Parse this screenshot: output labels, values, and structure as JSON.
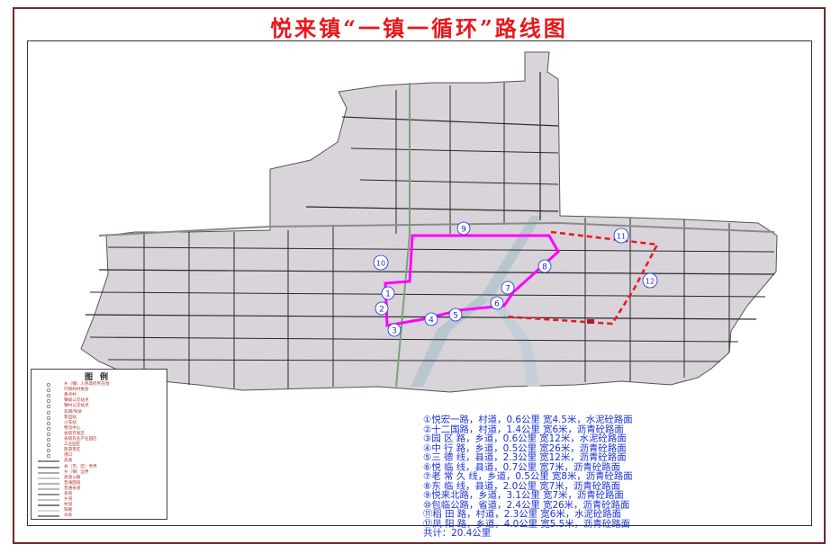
{
  "title": "悦来镇“一镇一循环”路线图",
  "colors": {
    "title": "#e8171b",
    "loop": "#ff00ff",
    "dashed_route": "#e8171b",
    "route_text": "#1a2fd6",
    "land": "#d9d3da",
    "river": "#b7c6cf"
  },
  "map": {
    "markers": [
      "1",
      "2",
      "3",
      "4",
      "5",
      "6",
      "7",
      "8",
      "9",
      "10",
      "11",
      "12"
    ]
  },
  "legend": {
    "title": "图例",
    "items": [
      "乡（镇）人民政府所在地",
      "行政村村委会",
      "重点村",
      "镇级公交站点",
      "镇村公交站点",
      "车辆/驾驶",
      "客运站",
      "火车站",
      "物流中心",
      "省级开发区",
      "省级农业产业园区",
      "工业园区",
      "旅游景区",
      "港口",
      "高速",
      "县（市、区）界界",
      "乡（镇）边界",
      "高速公路",
      "普通国道",
      "普通省道",
      "县道",
      "乡道",
      "村道",
      "铁路",
      "水系"
    ]
  },
  "routes": [
    "①悦宏一路，村道，0.6公里 宽4.5米，水泥砼路面",
    "②十二国路，村道，1.4公里 宽6米，沥青砼路面",
    "③园 区 路，乡道，0.6公里 宽12米，水泥砼路面",
    "④中 行 路，乡道，0.5公里 宽26米，沥青砼路面",
    "⑤三 德 线，县道，2.3公里 宽12米，沥青砼路面",
    "⑥悦 临 线，县道，0.7公里 宽7米，沥青砼路面",
    "⑦老 常 久 线，乡道，0.5公里 宽8米，沥青砼路面",
    "⑧东 临 线，县道，2.0公里 宽7米，沥青砼路面",
    "⑨悦来北路，乡道，3.1公里 宽7米，沥青砼路面",
    "⑩包临公路，省道，2.4公里 宽26米，沥青砼路面",
    "⑪稻 田 路，村道，2.3公里 宽6米，水泥砼路面",
    "⑫凤 阳 路，乡道，4.0公里 宽5.5米，沥青砼路面"
  ],
  "total": "共计：20.4公里"
}
